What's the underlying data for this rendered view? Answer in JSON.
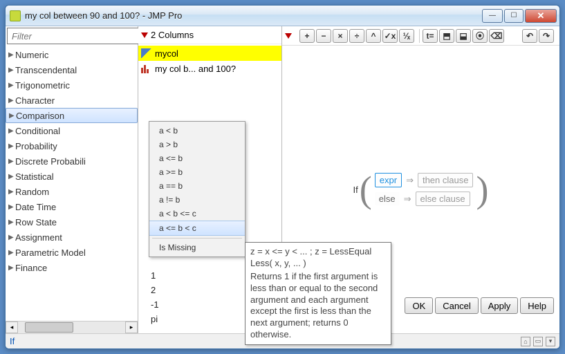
{
  "window": {
    "title": "my col between 90 and 100? - JMP Pro"
  },
  "left": {
    "filter_placeholder": "Filter",
    "categories": [
      {
        "label": "Numeric",
        "selected": false
      },
      {
        "label": "Transcendental",
        "selected": false
      },
      {
        "label": "Trigonometric",
        "selected": false
      },
      {
        "label": "Character",
        "selected": false
      },
      {
        "label": "Comparison",
        "selected": true
      },
      {
        "label": "Conditional",
        "selected": false
      },
      {
        "label": "Probability",
        "selected": false
      },
      {
        "label": "Discrete Probabili",
        "selected": false
      },
      {
        "label": "Statistical",
        "selected": false
      },
      {
        "label": "Random",
        "selected": false
      },
      {
        "label": "Date Time",
        "selected": false
      },
      {
        "label": "Row State",
        "selected": false
      },
      {
        "label": "Assignment",
        "selected": false
      },
      {
        "label": "Parametric Model",
        "selected": false
      },
      {
        "label": "Finance",
        "selected": false
      }
    ]
  },
  "mid": {
    "header": "2 Columns",
    "columns": [
      {
        "label": "mycol",
        "icon": "continuous",
        "highlight": true
      },
      {
        "label": "my col b... and 100?",
        "icon": "histogram",
        "highlight": false
      }
    ],
    "values": [
      "1",
      "2",
      "-1",
      "pi"
    ]
  },
  "toolbar": {
    "g1": [
      "+",
      "−",
      "×",
      "÷",
      "^",
      "✓x",
      "¹⁄ₓ"
    ],
    "g2": [
      "t=",
      "⬒",
      "⬓",
      "⦿",
      "⌫"
    ],
    "g3": [],
    "g4": [
      "↶",
      "↷"
    ]
  },
  "formula": {
    "keyword": "If",
    "rows": [
      {
        "left": "expr",
        "right": "then clause"
      },
      {
        "left": "else",
        "right": "else clause"
      }
    ]
  },
  "popup": {
    "items": [
      {
        "label": "a < b"
      },
      {
        "label": "a > b"
      },
      {
        "label": "a <= b"
      },
      {
        "label": "a >= b"
      },
      {
        "label": "a == b"
      },
      {
        "label": "a != b"
      },
      {
        "label": "a < b <= c"
      },
      {
        "label": "a <= b < c",
        "selected": true
      },
      {
        "sep": true
      },
      {
        "label": "Is Missing"
      }
    ]
  },
  "tooltip": {
    "syntax": "z = x <= y < ... ; z = LessEqual Less( x, y, ... )",
    "desc": "Returns 1 if the first argument is less than or equal to the second argument and each argument except the first is less than the next argument; returns 0 otherwise."
  },
  "buttons": [
    "OK",
    "Cancel",
    "Apply",
    "Help"
  ],
  "status": {
    "text": "If"
  }
}
